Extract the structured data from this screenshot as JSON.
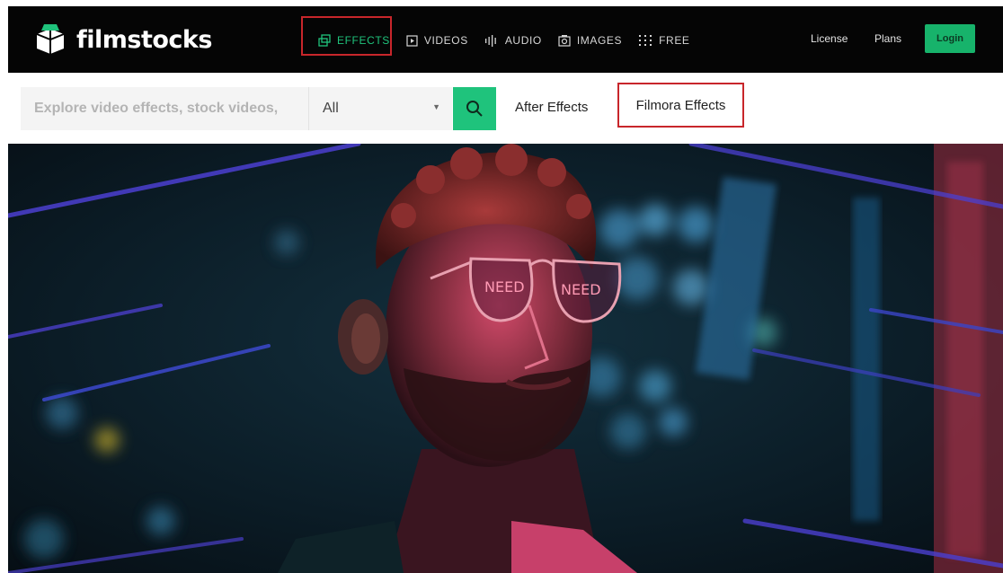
{
  "header": {
    "logo_text": "filmstocks",
    "nav": [
      {
        "label": "EFFECTS",
        "icon": "effects-icon"
      },
      {
        "label": "VIDEOS",
        "icon": "video-icon"
      },
      {
        "label": "AUDIO",
        "icon": "audio-icon"
      },
      {
        "label": "IMAGES",
        "icon": "image-icon"
      },
      {
        "label": "FREE",
        "icon": "grid-icon"
      }
    ],
    "license_label": "License",
    "plans_label": "Plans",
    "login_label": "Login"
  },
  "search": {
    "placeholder": "Explore video effects, stock videos,",
    "category_value": "All",
    "links": [
      "After Effects",
      "Filmora Effects"
    ]
  },
  "hero": {
    "reflection_text_left": "NEED",
    "reflection_text_right": "NEED"
  },
  "colors": {
    "accent_green": "#1fc37c",
    "highlight_red": "#c8262b",
    "topbar_bg": "#050505"
  }
}
